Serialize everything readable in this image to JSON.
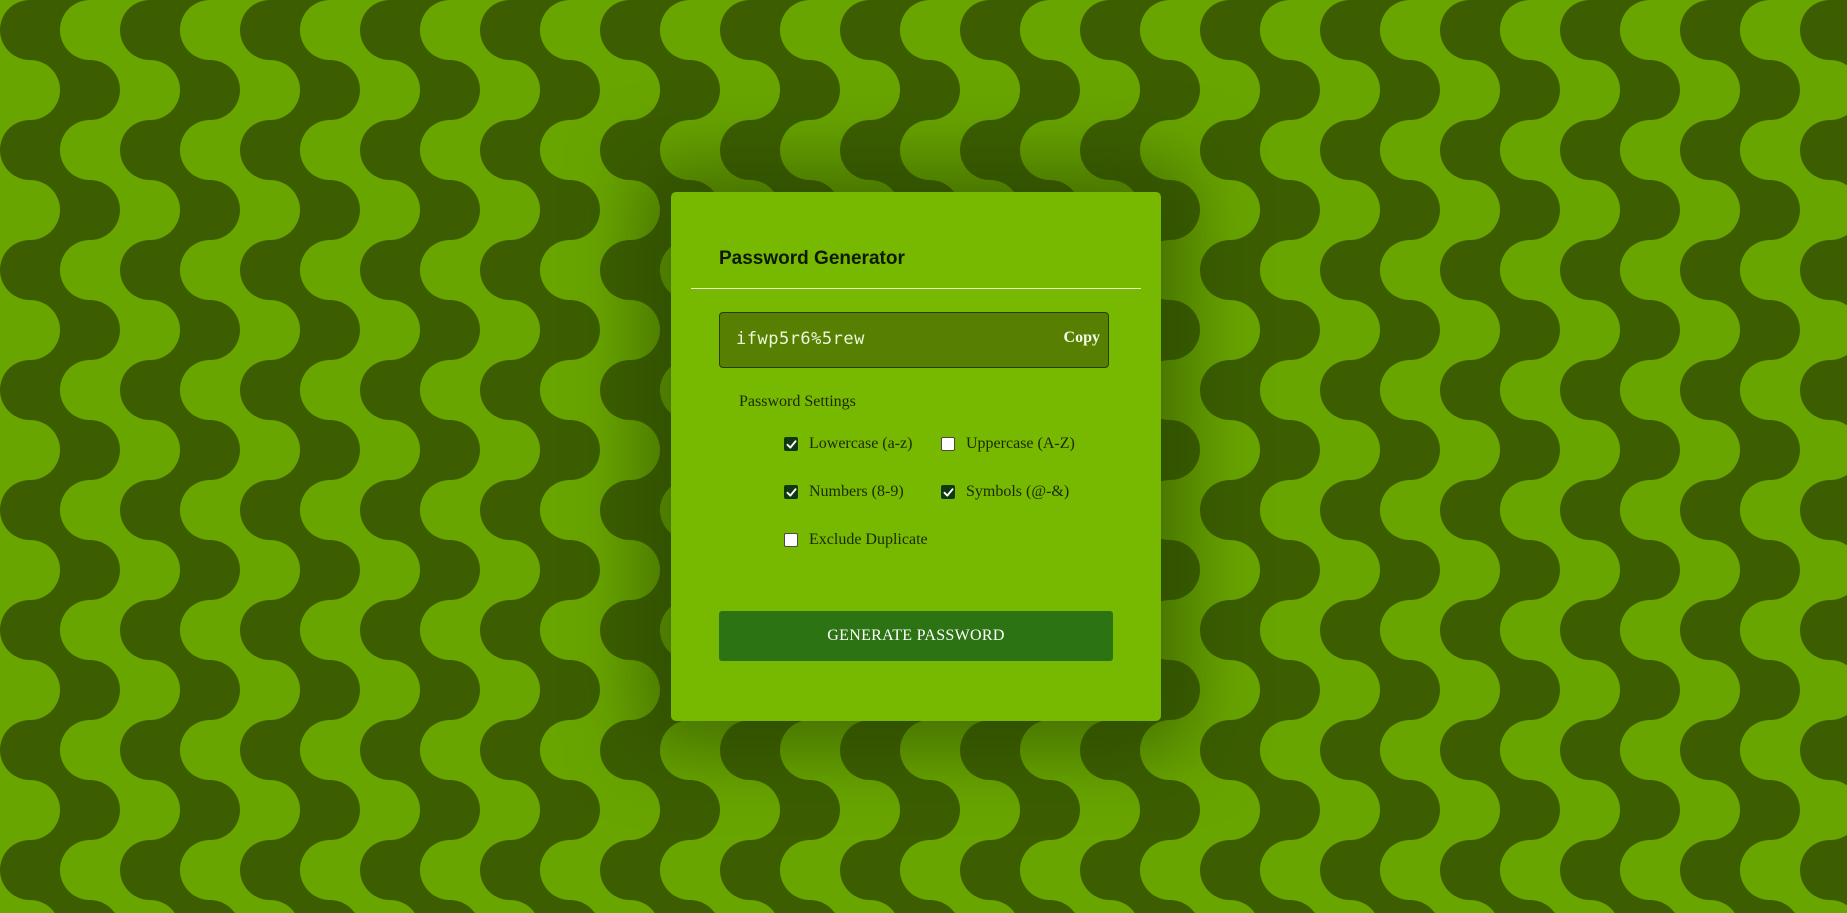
{
  "app": {
    "title": "Password Generator"
  },
  "password": {
    "value": "ifwp5r6%5rew",
    "copy_label": "Copy"
  },
  "settings": {
    "title": "Password Settings",
    "options": [
      {
        "label": "Lowercase (a-z)",
        "checked": true
      },
      {
        "label": "Uppercase (A-Z)",
        "checked": false
      },
      {
        "label": "Numbers (8-9)",
        "checked": true
      },
      {
        "label": "Symbols (@-&)",
        "checked": true
      },
      {
        "label": "Exclude Duplicate",
        "checked": false
      }
    ]
  },
  "generate": {
    "label": "GENERATE PASSWORD"
  },
  "colors": {
    "background_light": "#69a500",
    "background_dark": "#3c5e00",
    "card": "#77b800",
    "password_field": "#578002",
    "checkbox_checked": "#0f3a0f",
    "generate_button": "#2c7314"
  },
  "icons": {
    "checkmark": "check-icon"
  }
}
